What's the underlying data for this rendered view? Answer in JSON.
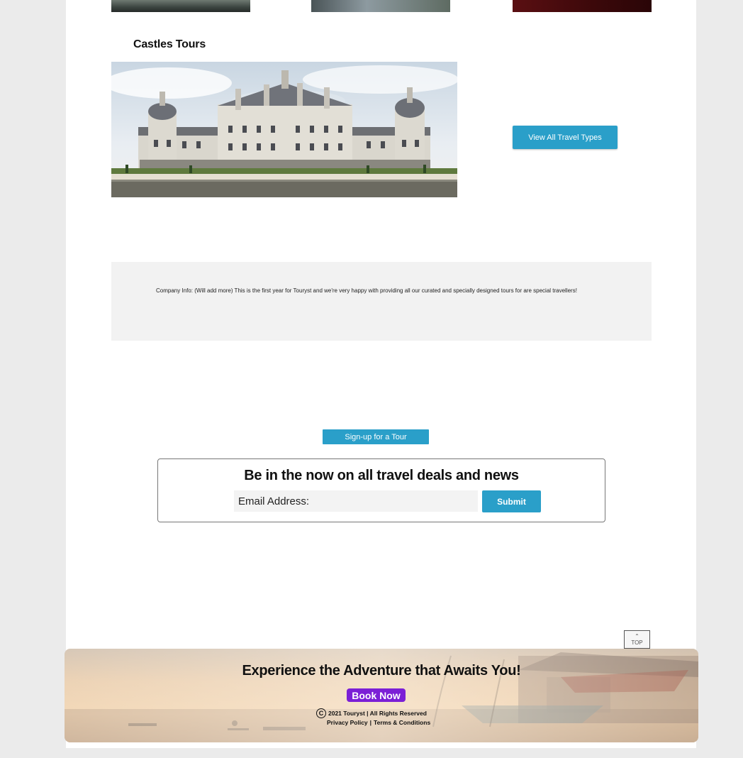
{
  "section": {
    "title": "Castles Tours"
  },
  "buttons": {
    "view_all": "View All Travel Types",
    "signup": "Sign-up for a Tour",
    "submit": "Submit",
    "top": "TOP",
    "book_now": "Book Now"
  },
  "company_info": {
    "text": "Company Info: (Will add more) This is the first year for Touryst and we're very happy with providing all our curated and specially designed  tours for are special travellers!"
  },
  "newsletter": {
    "title": "Be in the now on all travel deals and news",
    "email_placeholder": "Email Address:"
  },
  "footer": {
    "headline": "Experience the Adventure that Awaits You!",
    "copyright": "2021 Touryst | All Rights Reserved",
    "privacy": "Privacy Policy",
    "separator": "|",
    "terms": "Terms & Conditions"
  },
  "icons": {
    "top_arrow": "chevron-up-icon",
    "copyright": "copyright-icon"
  },
  "colors": {
    "accent_blue": "#2a9fc9",
    "book_purple": "#7b1fd6",
    "page_bg": "#ebebeb"
  }
}
